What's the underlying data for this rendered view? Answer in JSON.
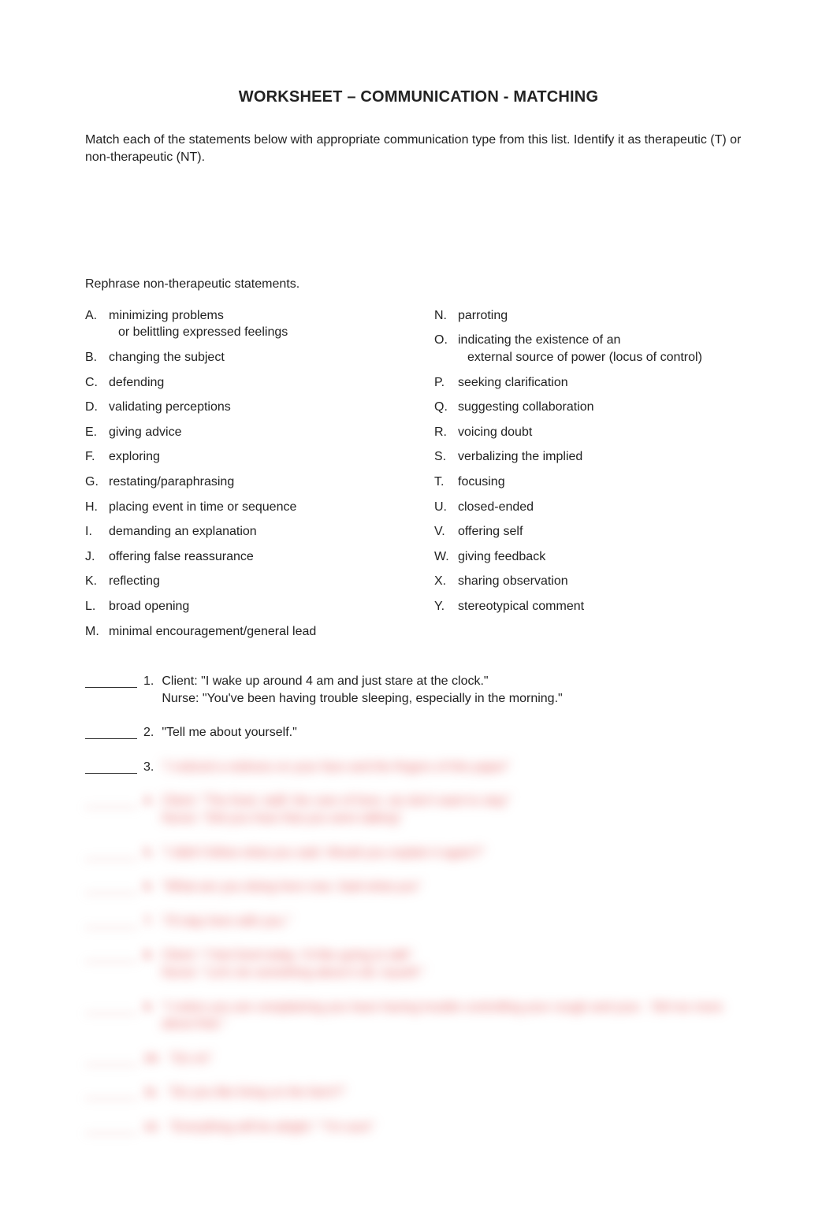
{
  "title": "WORKSHEET – COMMUNICATION - MATCHING",
  "instruction": "Match each of the statements below with appropriate communication type from this list.  Identify it as therapeutic (T) or non-therapeutic (NT).",
  "subinstruction": "Rephrase non-therapeutic statements.",
  "options_left": [
    {
      "letter": "A.",
      "text": "minimizing problems",
      "sub": "or belittling expressed feelings"
    },
    {
      "letter": "B.",
      "text": "changing the subject"
    },
    {
      "letter": "C.",
      "text": "defending"
    },
    {
      "letter": "D.",
      "text": "validating perceptions"
    },
    {
      "letter": "E.",
      "text": "giving advice"
    },
    {
      "letter": "F.",
      "text": "exploring"
    },
    {
      "letter": "G.",
      "text": "restating/paraphrasing"
    },
    {
      "letter": "H.",
      "text": "placing event in time or sequence"
    },
    {
      "letter": "I.",
      "text": "demanding an explanation"
    },
    {
      "letter": "J.",
      "text": "offering false reassurance"
    },
    {
      "letter": "K.",
      "text": " reflecting"
    },
    {
      "letter": "L.",
      "text": "broad opening"
    },
    {
      "letter": "M.",
      "text": " minimal encouragement/general lead"
    }
  ],
  "options_right": [
    {
      "letter": "N.",
      "text": "parroting"
    },
    {
      "letter": "O.",
      "text": "indicating the existence of an",
      "sub": "external source of power (locus of control)"
    },
    {
      "letter": "P.",
      "text": "seeking clarification"
    },
    {
      "letter": "Q.",
      "text": " suggesting collaboration"
    },
    {
      "letter": "R.",
      "text": " voicing doubt"
    },
    {
      "letter": "S.",
      "text": " verbalizing the implied"
    },
    {
      "letter": "T.",
      "text": "  focusing"
    },
    {
      "letter": "U.",
      "text": " closed-ended"
    },
    {
      "letter": "V.",
      "text": " offering self"
    },
    {
      "letter": "W.",
      "text": "  giving feedback"
    },
    {
      "letter": "X.",
      "text": "  sharing observation"
    },
    {
      "letter": "Y.",
      "text": "  stereotypical comment"
    }
  ],
  "q1": {
    "num": "1.",
    "line1": "Client:   \"I wake up around 4 am and just stare at the clock.\"",
    "line2": "Nurse:  \"You've been having trouble sleeping, especially in the morning.\""
  },
  "q2": {
    "num": "2.",
    "text": "\"Tell me about yourself.\""
  },
  "q3": {
    "num": "3.",
    "blurred": "\"I noticed a redness on your face and the fingers of this paper\""
  },
  "blurred_items": [
    {
      "num": "4.",
      "text": "Client:   \"The food, staff, the care of here,   we don't want to stay\"\nNurse:   \"Did you hear that you were talking\""
    },
    {
      "num": "5.",
      "text": "\"I didn't follow what you said.  Would you explain it again?\""
    },
    {
      "num": "6.",
      "text": "\"What are you doing here now.  Said what you\""
    },
    {
      "num": "7.",
      "text": "\"I'll stay here with you.\""
    },
    {
      "num": "8.",
      "text": "Client:   \"I feel tired today.  I'd like going to talk\"\nNurse:   \"Let's do something about it all, myself.\""
    },
    {
      "num": "9.",
      "text": "\"I notice you are complaining you have having trouble controlling your cough and your .  Tell me     more about that.\""
    },
    {
      "num": "10.",
      "text": "\"Go on\""
    },
    {
      "num": "11.",
      "text": "\"Do you like living on the farm?\""
    },
    {
      "num": "12.",
      "text": "\"Everything will be alright.\"  \"I'm sure\""
    }
  ]
}
